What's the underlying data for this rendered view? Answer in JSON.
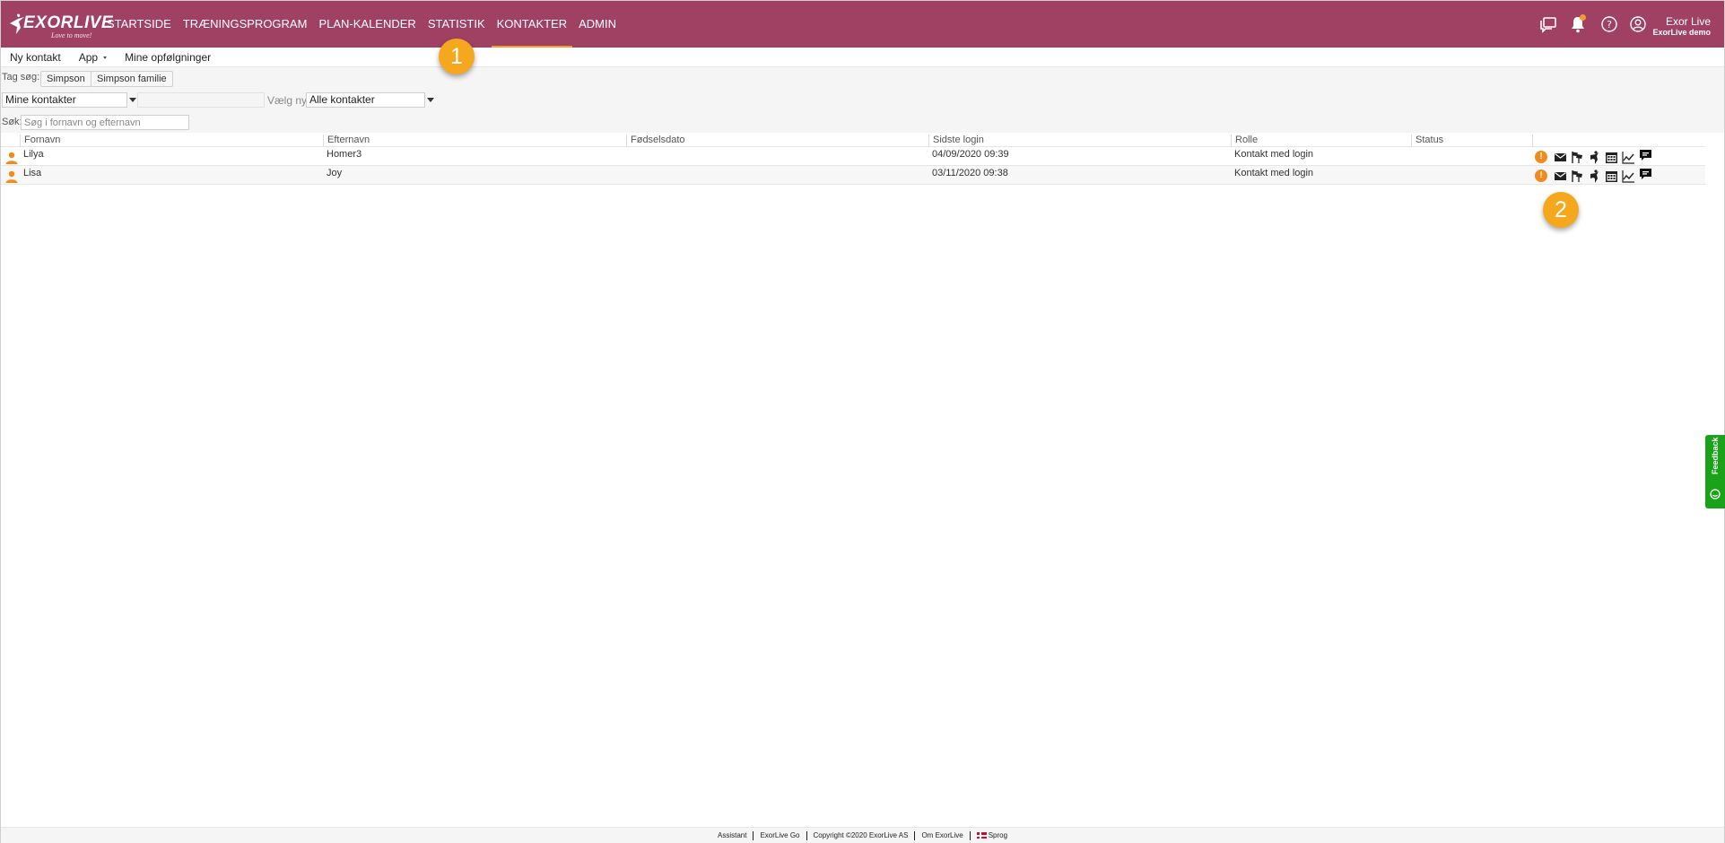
{
  "brand": {
    "logo_text": "EXORLIVE",
    "tagline": "Love to move!"
  },
  "nav": {
    "items": [
      {
        "label": "STARTSIDE"
      },
      {
        "label": "TRÆNINGSPROGRAM"
      },
      {
        "label": "PLAN-KALENDER"
      },
      {
        "label": "STATISTIK"
      },
      {
        "label": "KONTAKTER",
        "active": true
      },
      {
        "label": "ADMIN"
      }
    ]
  },
  "header_icons": [
    "chat-icon",
    "bell-icon",
    "help-icon",
    "user-icon"
  ],
  "user": {
    "name": "Exor Live",
    "org": "ExorLive demo"
  },
  "submenu": {
    "new_contact": "Ny kontakt",
    "app": "App",
    "followups": "Mine opfølgninger"
  },
  "filters": {
    "tag_label": "Tag søg:",
    "tags": [
      "Simpson",
      "Simpson familie"
    ],
    "contacts_select": "Mine kontakter",
    "choose_new_label": "Vælg ny",
    "all_contacts_select": "Alle kontakter",
    "search_label": "Søk:",
    "search_placeholder": "Søg i fornavn og efternavn"
  },
  "table": {
    "columns": [
      "Fornavn",
      "Efternavn",
      "Fødselsdato",
      "Sidste login",
      "Rolle",
      "Status"
    ],
    "rows": [
      {
        "first": "Lilya",
        "last": "Homer3",
        "birth": "",
        "last_login": "04/09/2020 09:39",
        "role": "Kontakt med login",
        "status": ""
      },
      {
        "first": "Lisa",
        "last": "Joy",
        "birth": "",
        "last_login": "03/11/2020 09:38",
        "role": "Kontakt med login",
        "status": ""
      }
    ],
    "row_actions": [
      "info-icon",
      "mail-icon",
      "flags-icon",
      "exercise-icon",
      "calendar-icon",
      "chart-icon",
      "message-icon"
    ]
  },
  "callouts": {
    "one": "1",
    "two": "2"
  },
  "feedback": {
    "label": "Feedback"
  },
  "footer": {
    "links": [
      "Assistant",
      "ExorLive Go",
      "Copyright ©2020 ExorLive AS",
      "Om ExorLive",
      "Sprog"
    ]
  },
  "colors": {
    "topbar": "#a04163",
    "accent": "#f29a2e",
    "callout": "#f5a81d",
    "feedback": "#1aa31a"
  }
}
